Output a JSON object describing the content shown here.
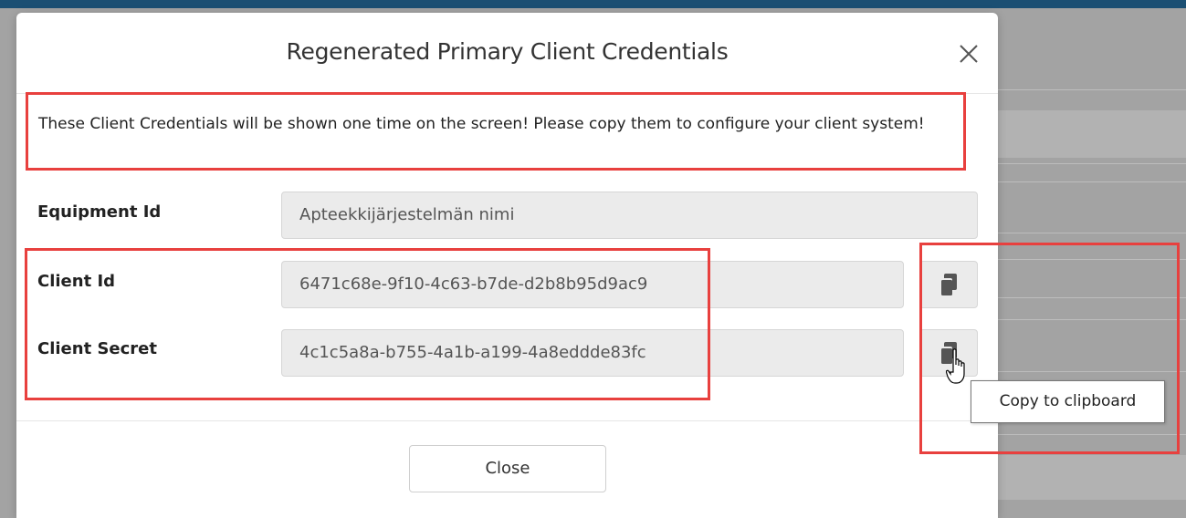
{
  "modal": {
    "title": "Regenerated Primary Client Credentials",
    "notice": "These Client Credentials will be shown one time on the screen! Please copy them to configure your client system!",
    "fields": [
      {
        "label": "Equipment Id",
        "value": "Apteekkijärjestelmän nimi"
      },
      {
        "label": "Client Id",
        "value": "6471c68e-9f10-4c63-b7de-d2b8b95d9ac9"
      },
      {
        "label": "Client Secret",
        "value": "4c1c5a8a-b755-4a1b-a199-4a8eddde83fc"
      }
    ],
    "close_button": "Close"
  },
  "tooltip": {
    "text": "Copy to clipboard"
  },
  "icons": {
    "close": "close-icon",
    "copy": "copy-icon",
    "cursor": "hand-cursor-icon"
  },
  "colors": {
    "topbar": "#1b4f73",
    "annotation": "#e8403e"
  }
}
